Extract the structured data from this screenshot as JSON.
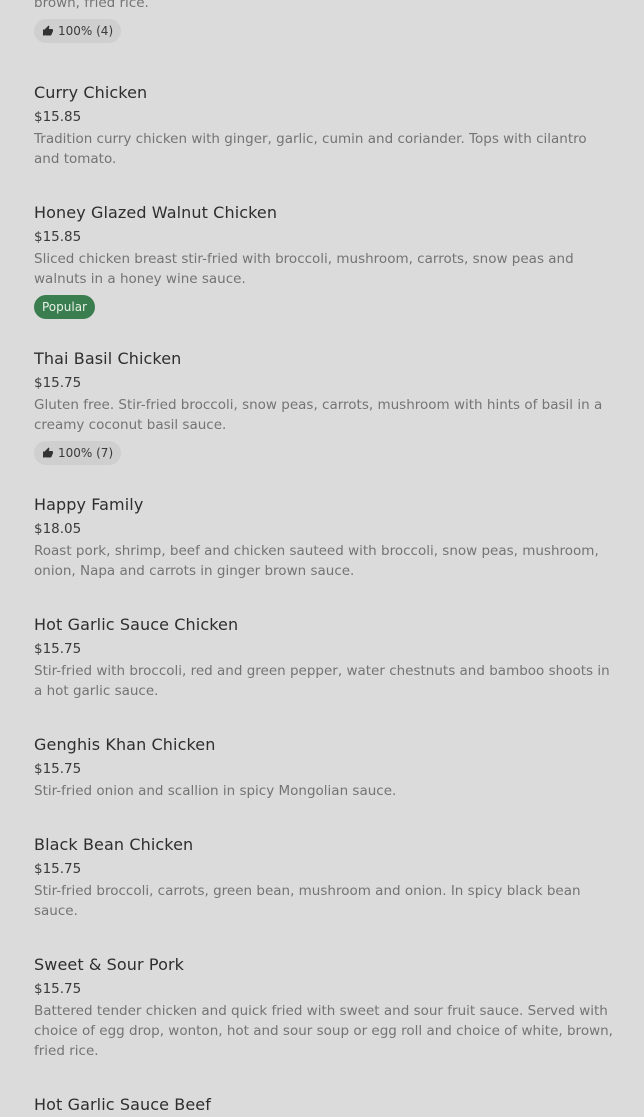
{
  "items": [
    {
      "name": "",
      "price": "",
      "desc": "brown, fried rice.",
      "rating": "100% (4)",
      "popular": ""
    },
    {
      "name": "Curry Chicken",
      "price": "$15.85",
      "desc": "Tradition curry chicken with ginger, garlic, cumin and coriander. Tops with cilantro and tomato.",
      "rating": "",
      "popular": ""
    },
    {
      "name": "Honey Glazed Walnut Chicken",
      "price": "$15.85",
      "desc": "Sliced chicken breast stir-fried with broccoli, mushroom, carrots, snow peas and walnuts in a honey wine sauce.",
      "rating": "",
      "popular": "Popular"
    },
    {
      "name": "Thai Basil Chicken",
      "price": "$15.75",
      "desc": "Gluten free. Stir-fried broccoli, snow peas, carrots, mushroom with hints of basil in a creamy coconut basil sauce.",
      "rating": "100% (7)",
      "popular": ""
    },
    {
      "name": "Happy Family",
      "price": "$18.05",
      "desc": "Roast pork, shrimp, beef and chicken sauteed with broccoli, snow peas, mushroom, onion, Napa and carrots in ginger brown sauce.",
      "rating": "",
      "popular": ""
    },
    {
      "name": "Hot Garlic Sauce Chicken",
      "price": "$15.75",
      "desc": "Stir-fried with broccoli, red and green pepper, water chestnuts and bamboo shoots in a hot garlic sauce.",
      "rating": "",
      "popular": ""
    },
    {
      "name": "Genghis Khan Chicken",
      "price": "$15.75",
      "desc": "Stir-fried onion and scallion in spicy Mongolian sauce.",
      "rating": "",
      "popular": ""
    },
    {
      "name": "Black Bean Chicken",
      "price": "$15.75",
      "desc": "Stir-fried broccoli, carrots, green bean, mushroom and onion. In spicy black bean sauce.",
      "rating": "",
      "popular": ""
    },
    {
      "name": "Sweet & Sour Pork",
      "price": "$15.75",
      "desc": "Battered tender chicken and quick fried with sweet and sour fruit sauce. Served with choice of egg drop, wonton, hot and sour soup or egg roll and choice of white, brown, fried rice.",
      "rating": "",
      "popular": ""
    },
    {
      "name": "Hot Garlic Sauce Beef",
      "price": "",
      "desc": "",
      "rating": "",
      "popular": ""
    }
  ],
  "icons": {
    "rating": "thumbs-up-icon"
  },
  "colors": {
    "background": "#dbdbdb",
    "popular_badge": "#3a7d4e",
    "rating_badge": "#cfcfcf"
  }
}
